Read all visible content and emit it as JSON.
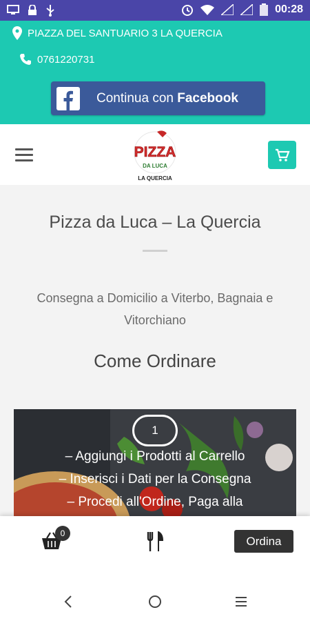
{
  "status_bar": {
    "time": "00:28"
  },
  "top_bar": {
    "address": "PIAZZA DEL SANTUARIO 3 LA QUERCIA",
    "phone": "0761220731",
    "facebook_button_prefix": "Continua con ",
    "facebook_button_brand": "Facebook"
  },
  "header": {
    "logo": {
      "line1": "PIZZA",
      "line2": "DA LUCA",
      "line3": "LA QUERCIA"
    }
  },
  "main": {
    "title": "Pizza da Luca – La Quercia",
    "subtitle": "Consegna a Domicilio a Viterbo, Bagnaia e Vitorchiano",
    "section_title": "Come Ordinare",
    "promo": {
      "step": "1",
      "lines": [
        "– Aggiungi i Prodotti al Carrello",
        "– Inserisci i Dati per la Consegna",
        "– Procedi all'Ordine, Paga alla"
      ]
    }
  },
  "bottom_nav": {
    "cart_count": "0",
    "order_label": "Ordina"
  },
  "colors": {
    "teal": "#1dc9b2",
    "status_bar": "#4a45a8",
    "facebook": "#3b5a9a"
  },
  "icons": [
    "monitor-icon",
    "lock-icon",
    "usb-icon",
    "alarm-icon",
    "wifi-icon",
    "signal-icon",
    "battery-icon",
    "location-pin-icon",
    "phone-icon",
    "facebook-icon",
    "hamburger-icon",
    "cart-icon",
    "basket-icon",
    "cutlery-icon",
    "back-icon",
    "home-icon",
    "menu-icon"
  ]
}
